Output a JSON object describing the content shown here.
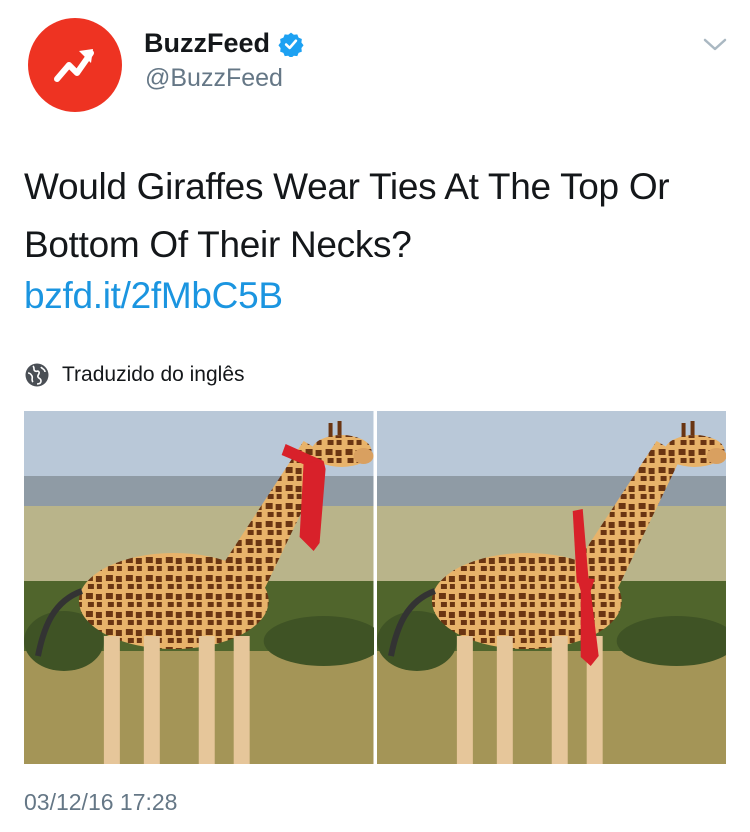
{
  "tweet": {
    "author": {
      "display_name": "BuzzFeed",
      "handle": "@BuzzFeed",
      "verified": true,
      "avatar_icon": "buzzfeed-trending-arrow-icon",
      "avatar_color": "#ee3322"
    },
    "menu_icon": "chevron-down-icon",
    "text": "Would Giraffes Wear Ties At The Top Or Bottom Of Their Necks?",
    "link": "bzfd.it/2fMbC5B",
    "translation_notice": "Traduzido do inglês",
    "translation_icon": "globe-icon",
    "media": [
      {
        "description_icon": "giraffe-with-tie-at-top-image"
      },
      {
        "description_icon": "giraffe-with-tie-at-bottom-image"
      }
    ],
    "timestamp": "03/12/16 17:28"
  },
  "colors": {
    "link": "#1b95e0",
    "secondary_text": "#657786",
    "verified_badge": "#1da1f2",
    "tie": "#d8212a"
  }
}
